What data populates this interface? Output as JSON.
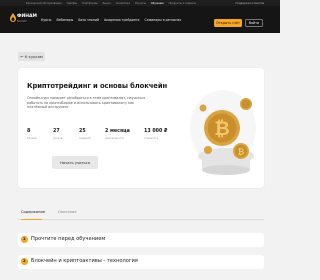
{
  "topbar": {
    "links": [
      "Брокерский обслуживание",
      "Тарифы",
      "Платформы",
      "Рынок",
      "Аналитика",
      "Ресурсы",
      "Обучение",
      "Продукты и сервисы"
    ],
    "right": "Поддержка клиентов"
  },
  "header": {
    "brand": "ФИНАМ",
    "brand_sub": "БРОКЕР",
    "nav": [
      "Курсы",
      "Вебинары",
      "База знаний",
      "Академия трейдинга",
      "Семинары в регионах"
    ],
    "open_account": "Открыть счёт",
    "login": "Войти"
  },
  "back_label": "← К курсам",
  "course": {
    "title": "Криптотрейдинг и основы блокчейн",
    "description": "Онлайн-курс поможет разобраться в теме криптовалют, научиться работать на криптобирже и использовать криптовалюту как платёжный инструмент",
    "stats": [
      {
        "value": "8",
        "label": "блоков"
      },
      {
        "value": "27",
        "label": "уроков"
      },
      {
        "value": "25",
        "label": "заданий"
      },
      {
        "value": "2 месяца",
        "label": "длительность"
      },
      {
        "value": "13 000 ₽",
        "label": "стоимость"
      }
    ],
    "start_button": "Начать учиться",
    "illustration_icon": "bitcoin-coins-icon"
  },
  "tabs": [
    "Содержание",
    "Описание"
  ],
  "sections": [
    {
      "number": "1",
      "title": "Прочтите перед обучением"
    },
    {
      "number": "2",
      "title": "Блокчейн и криптоактивы - технология"
    }
  ],
  "colors": {
    "accent": "#f5a623",
    "header_bg": "#151515",
    "page_bg": "#f2f2f2"
  }
}
